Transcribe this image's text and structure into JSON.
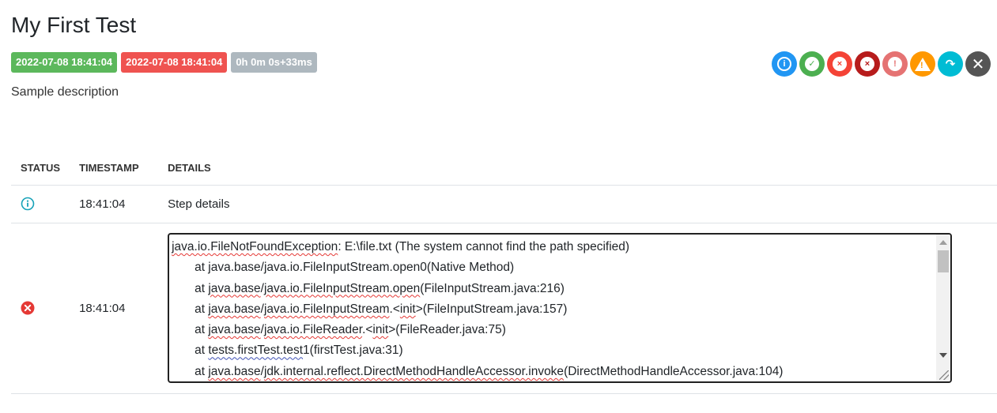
{
  "test": {
    "title": "My First Test",
    "start_time": "2022-07-08 18:41:04",
    "end_time": "2022-07-08 18:41:04",
    "duration": "0h 0m 0s+33ms",
    "description": "Sample description"
  },
  "filters": {
    "info": "i",
    "pass": "✓",
    "fail": "×",
    "fatal": "×",
    "error": "!",
    "warning": "!",
    "skip": "↷",
    "clear": "✕"
  },
  "colors": {
    "info": "#2196f3",
    "pass": "#4caf50",
    "fail": "#f44336",
    "fatal": "#b71c1c",
    "error": "#e57373",
    "warning": "#ff9800",
    "skip": "#00bcd4",
    "clear": "#555555"
  },
  "table": {
    "headers": {
      "status": "STATUS",
      "timestamp": "TIMESTAMP",
      "details": "DETAILS"
    },
    "rows": [
      {
        "status": "info",
        "timestamp": "18:41:04",
        "details": "Step details"
      },
      {
        "status": "fail",
        "timestamp": "18:41:04"
      }
    ]
  },
  "trace": {
    "l1_class": "java.io.FileNotFoundException",
    "l1_msg": ": E:\\file.txt (The system cannot find the path specified)",
    "l2": "at java.base/java.io.FileInputStream.open0(Native Method)",
    "l3_pre": "at ",
    "l3_a": "java.base",
    "l3_b": "/",
    "l3_c": "java.io.FileInputStream.open",
    "l3_d": "(FileInputStream.java:216)",
    "l4_pre": "at ",
    "l4_a": "java.base",
    "l4_b": "/",
    "l4_c": "java.io.FileInputStream",
    "l4_d": ".<",
    "l4_e": "init",
    "l4_f": ">(FileInputStream.java:157)",
    "l5_pre": "at ",
    "l5_a": "java.base",
    "l5_b": "/",
    "l5_c": "java.io.FileReader",
    "l5_d": ".<",
    "l5_e": "init",
    "l5_f": ">(FileReader.java:75)",
    "l6_pre": "at ",
    "l6_a": "tests.firstTest.test",
    "l6_b": "1(firstTest.java:31)",
    "l7_pre": "at ",
    "l7_a": "java.base",
    "l7_b": "/",
    "l7_c": "jdk.internal.reflect.DirectMethodHandleAccessor.invoke",
    "l7_d": "(DirectMethodHandleAccessor.java:104)"
  }
}
